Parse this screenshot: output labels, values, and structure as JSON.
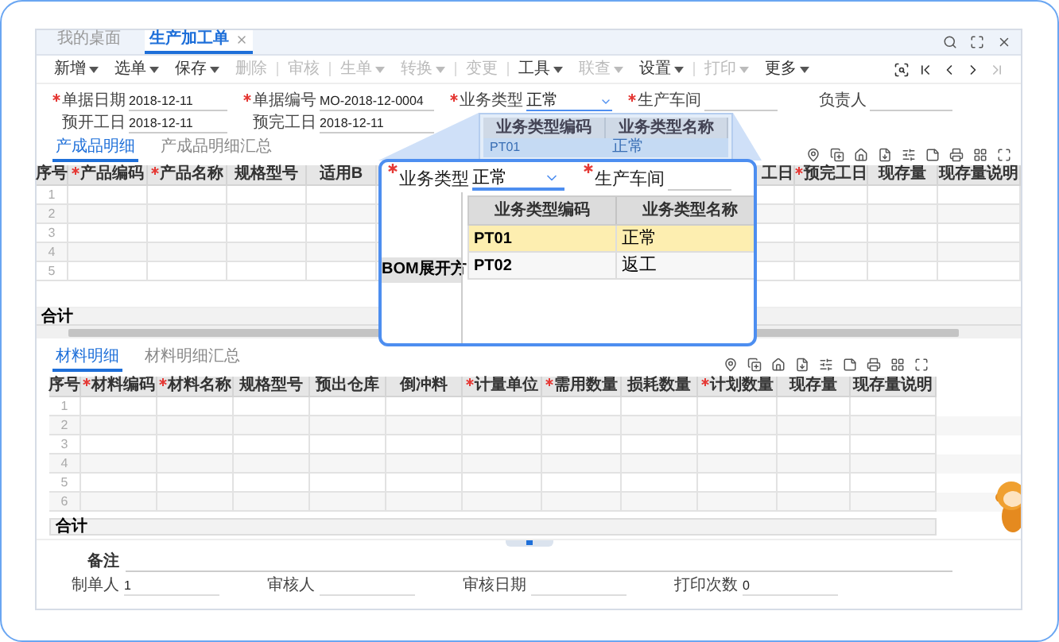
{
  "window_tabs": [
    {
      "label": "我的桌面",
      "selected": false,
      "closable": false
    },
    {
      "label": "生产加工单",
      "selected": true,
      "closable": true
    }
  ],
  "toolbar": [
    {
      "kind": "button",
      "label": "新增",
      "menu": true,
      "disabled": false
    },
    {
      "kind": "button",
      "label": "选单",
      "menu": true,
      "disabled": false
    },
    {
      "kind": "button",
      "label": "保存",
      "menu": true,
      "disabled": false
    },
    {
      "kind": "button",
      "label": "删除",
      "menu": false,
      "disabled": true
    },
    {
      "kind": "separator"
    },
    {
      "kind": "button",
      "label": "审核",
      "menu": false,
      "disabled": true
    },
    {
      "kind": "separator"
    },
    {
      "kind": "button",
      "label": "生单",
      "menu": true,
      "disabled": true
    },
    {
      "kind": "button",
      "label": "转换",
      "menu": true,
      "disabled": true
    },
    {
      "kind": "separator"
    },
    {
      "kind": "button",
      "label": "变更",
      "menu": false,
      "disabled": true
    },
    {
      "kind": "separator"
    },
    {
      "kind": "button",
      "label": "工具",
      "menu": true,
      "disabled": false
    },
    {
      "kind": "button",
      "label": "联查",
      "menu": true,
      "disabled": true
    },
    {
      "kind": "button",
      "label": "设置",
      "menu": true,
      "disabled": false
    },
    {
      "kind": "separator"
    },
    {
      "kind": "button",
      "label": "打印",
      "menu": true,
      "disabled": true
    },
    {
      "kind": "button",
      "label": "更多",
      "menu": true,
      "disabled": false
    }
  ],
  "form": {
    "rows": [
      [
        {
          "kind": "text",
          "label": "单据日期",
          "required": true,
          "value": "2018-12-11"
        },
        {
          "kind": "text",
          "label": "单据编号",
          "required": true,
          "value": "MO-2018-12-0004"
        },
        {
          "kind": "select",
          "label": "业务类型",
          "required": true,
          "value": "正常"
        },
        {
          "kind": "text",
          "label": "生产车间",
          "required": true
        },
        {
          "kind": "text",
          "label": "负责人",
          "required": false
        }
      ],
      [
        {
          "kind": "text",
          "label": "预开工日",
          "required": false,
          "value": "2018-12-11"
        },
        {
          "kind": "text",
          "label": "预完工日",
          "required": false,
          "value": "2018-12-11"
        }
      ]
    ]
  },
  "type_dropdown": {
    "columns": [
      "业务类型编码",
      "业务类型名称"
    ],
    "rows": [
      {
        "code": "PT01",
        "name": "正常",
        "selected": true
      }
    ]
  },
  "product_tabs": [
    {
      "label": "产成品明细",
      "selected": true
    },
    {
      "label": "产成品明细汇总",
      "selected": false
    }
  ],
  "product_table": {
    "columns": [
      {
        "label": "序号",
        "required": false
      },
      {
        "label": "产品编码",
        "required": true
      },
      {
        "label": "产品名称",
        "required": true
      },
      {
        "label": "规格型号",
        "required": false
      },
      {
        "label": "适用B",
        "required": false
      },
      {
        "label": "工日",
        "required": false
      },
      {
        "label": "预完工日",
        "required": true
      },
      {
        "label": "现存量",
        "required": false
      },
      {
        "label": "现存量说明",
        "required": false
      }
    ],
    "rows": [
      "1",
      "2",
      "3",
      "4",
      "5"
    ],
    "total_label": "合计"
  },
  "magnifier": {
    "field_label": "业务类型",
    "field_required": true,
    "field_value": "正常",
    "second_label": "生产车间",
    "second_required": true,
    "underlying_header": "BOM展开方",
    "columns": [
      "业务类型编码",
      "业务类型名称"
    ],
    "rows": [
      {
        "code": "PT01",
        "name": "正常",
        "selected": true
      },
      {
        "code": "PT02",
        "name": "返工",
        "selected": false
      }
    ]
  },
  "material_tabs": [
    {
      "label": "材料明细",
      "selected": true
    },
    {
      "label": "材料明细汇总",
      "selected": false
    }
  ],
  "material_table": {
    "columns": [
      {
        "label": "序号",
        "required": false
      },
      {
        "label": "材料编码",
        "required": true
      },
      {
        "label": "材料名称",
        "required": true
      },
      {
        "label": "规格型号",
        "required": false
      },
      {
        "label": "预出仓库",
        "required": false
      },
      {
        "label": "倒冲料",
        "required": false
      },
      {
        "label": "计量单位",
        "required": true
      },
      {
        "label": "需用数量",
        "required": true
      },
      {
        "label": "损耗数量",
        "required": false
      },
      {
        "label": "计划数量",
        "required": true
      },
      {
        "label": "现存量",
        "required": false
      },
      {
        "label": "现存量说明",
        "required": false
      }
    ],
    "rows": [
      "1",
      "2",
      "3",
      "4",
      "5",
      "6"
    ],
    "total_label": "合计"
  },
  "remark": {
    "label": "备注"
  },
  "footer": [
    {
      "label": "制单人",
      "value": "1"
    },
    {
      "label": "审核人"
    },
    {
      "label": "审核日期"
    },
    {
      "label": "打印次数",
      "value": "0"
    }
  ]
}
